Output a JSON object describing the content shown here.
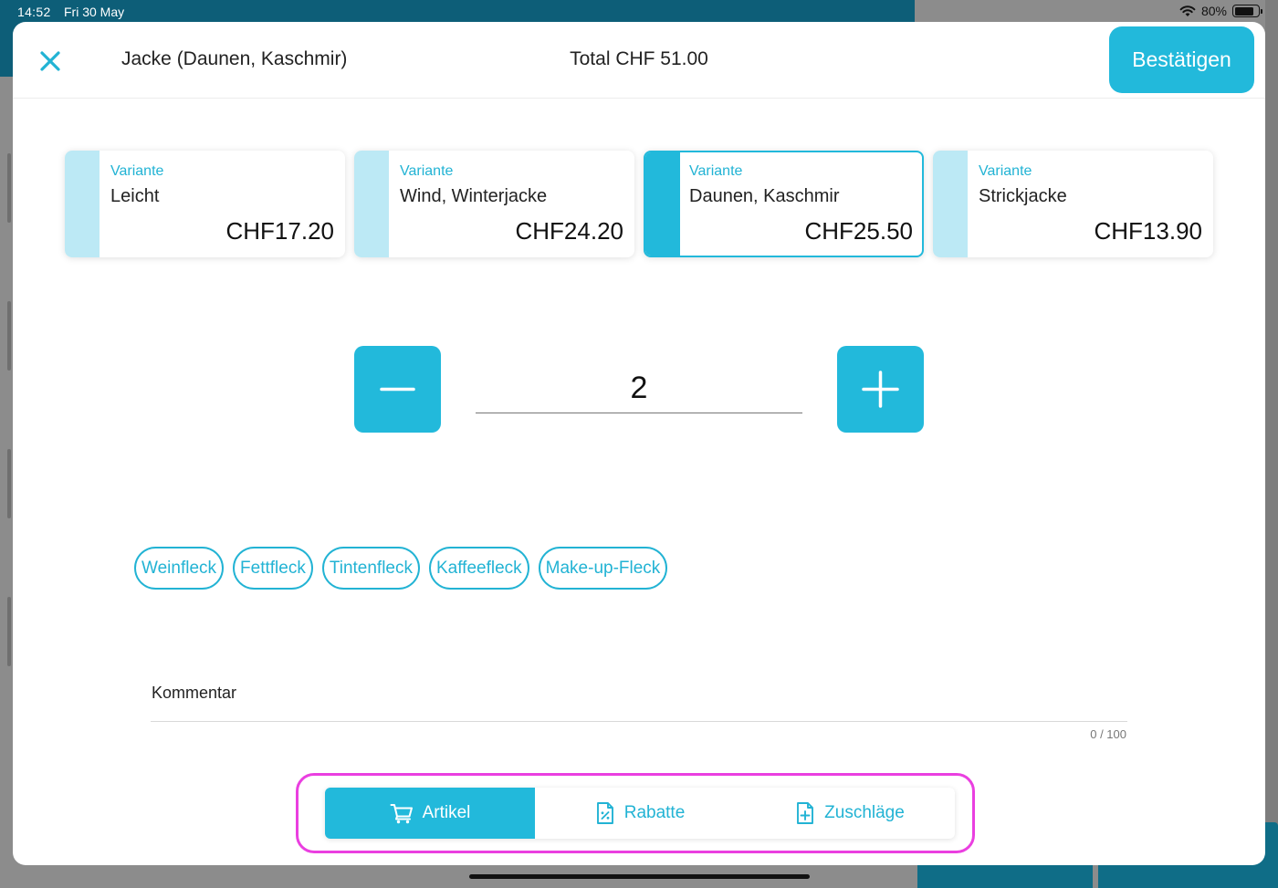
{
  "status_bar": {
    "time": "14:52",
    "date": "Fri 30 May",
    "battery_label": "80%",
    "battery_level": 0.8
  },
  "header": {
    "close_icon": "close-x-icon",
    "item_title": "Jacke (Daunen, Kaschmir)",
    "total": "Total CHF 51.00",
    "confirm_label": "Bestätigen"
  },
  "variants": [
    {
      "caption": "Variante",
      "name": "Leicht",
      "price": "CHF17.20",
      "selected": false
    },
    {
      "caption": "Variante",
      "name": "Wind, Winterjacke",
      "price": "CHF24.20",
      "selected": false
    },
    {
      "caption": "Variante",
      "name": "Daunen, Kaschmir",
      "price": "CHF25.50",
      "selected": true
    },
    {
      "caption": "Variante",
      "name": "Strickjacke",
      "price": "CHF13.90",
      "selected": false
    }
  ],
  "quantity": {
    "value": "2",
    "minus_icon": "minus-icon",
    "plus_icon": "plus-icon"
  },
  "tags": [
    "Weinfleck",
    "Fettfleck",
    "Tintenfleck",
    "Kaffeefleck",
    "Make-up-Fleck"
  ],
  "comment": {
    "label": "Kommentar",
    "value": "",
    "counter": "0 / 100"
  },
  "tabs": [
    {
      "label": "Artikel",
      "icon": "cart-icon",
      "active": true
    },
    {
      "label": "Rabatte",
      "icon": "discount-document-icon",
      "active": false
    },
    {
      "label": "Zuschläge",
      "icon": "add-document-icon",
      "active": false
    }
  ],
  "colors": {
    "accent": "#22b9db",
    "accent_light": "#bce9f5",
    "highlight": "#ea3fe0"
  }
}
